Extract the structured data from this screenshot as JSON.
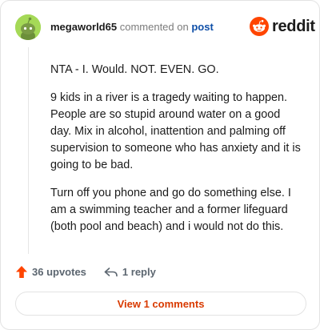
{
  "comment": {
    "username": "megaworld65",
    "action_text": "commented on",
    "post_link": "post",
    "paragraphs": [
      "NTA - I. Would. NOT. EVEN. GO.",
      "9 kids in a river is a tragedy waiting to happen. People are so stupid around water on a good day. Mix in alcohol, inattention and palming off supervision to someone who has anxiety and it is going to be bad.",
      "Turn off you phone and go do something else. I am a swimming teacher and a former lifeguard (both pool and beach) and i would not do this."
    ],
    "upvotes_label": "36 upvotes",
    "replies_label": "1 reply"
  },
  "brand": {
    "logo_text": "reddit",
    "accent": "#ff4500"
  },
  "footer": {
    "view_button_label": "View 1 comments"
  },
  "colors": {
    "avatar_bg": "#a5d957",
    "upvote": "#ff4500",
    "link": "#0f4fa8",
    "view_text": "#d93a00"
  }
}
